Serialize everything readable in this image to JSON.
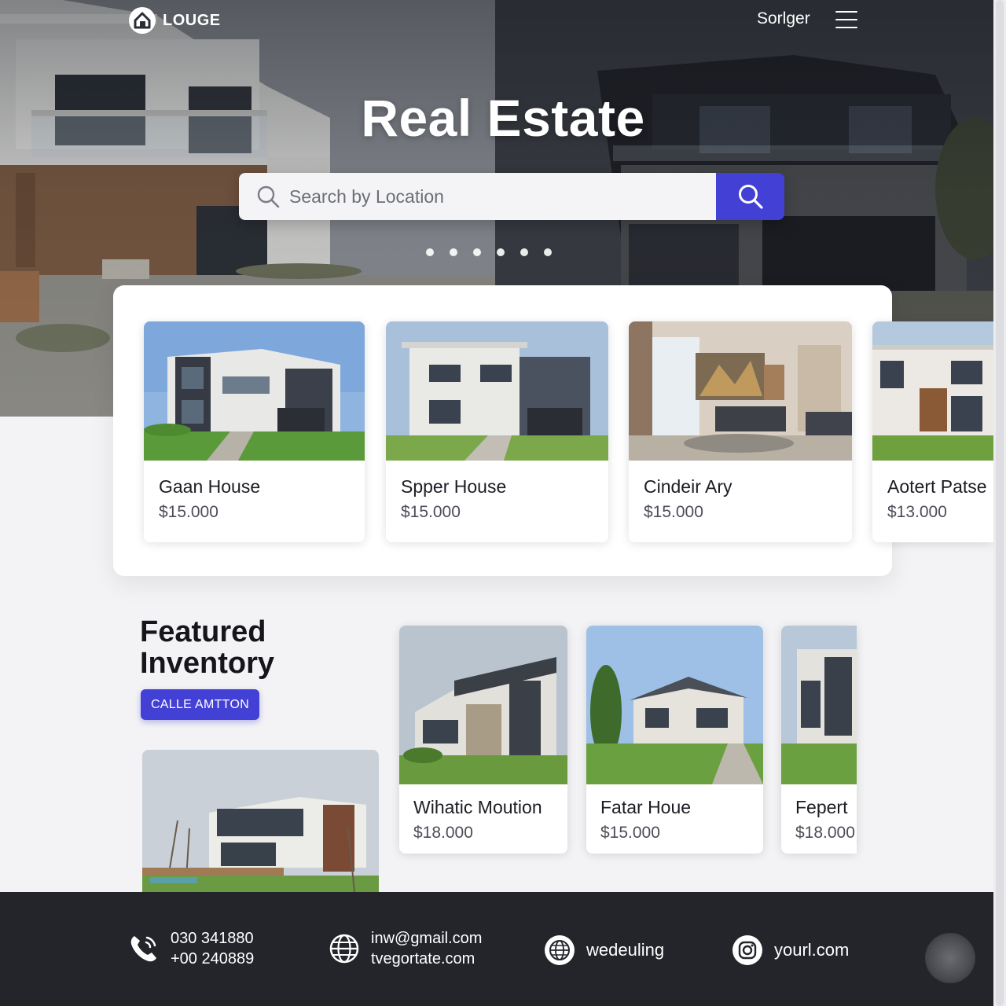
{
  "brand": {
    "name": "LOUGE"
  },
  "nav": {
    "link": "Sorlger",
    "menu_icon": "hamburger-menu-icon"
  },
  "hero": {
    "title": "Real Estate",
    "search_placeholder": "Search by Location",
    "carousel_dots": 6
  },
  "listings": [
    {
      "name": "Gaan House",
      "price": "$15.000",
      "photo": "modern-house-dark"
    },
    {
      "name": "Spper House",
      "price": "$15.000",
      "photo": "modern-house-grey"
    },
    {
      "name": "Cindeir Ary",
      "price": "$15.000",
      "photo": "living-room-interior"
    },
    {
      "name": "Aotert Patse",
      "price": "$13.000",
      "photo": "house-wood-accent"
    }
  ],
  "featured": {
    "title_line1": "Featured",
    "title_line2": "Inventory",
    "cta_label": "CALLE AMTTON",
    "cards": [
      {
        "name": "Wihatic Moution",
        "price": "$18.000"
      },
      {
        "name": "Fatar Houe",
        "price": "$15.000"
      },
      {
        "name": "Fepert",
        "price": "$18.000"
      }
    ]
  },
  "footer": {
    "phone": {
      "line1": "030 341880",
      "line2": "+00 240889",
      "icon": "phone-icon"
    },
    "web": {
      "line1": "inw@gmail.com",
      "line2": "tvegortate.com",
      "icon": "globe-icon"
    },
    "social": {
      "label": "wedeuling",
      "icon": "globe-circle-icon"
    },
    "instagram": {
      "label": "yourl.com",
      "icon": "instagram-icon"
    }
  },
  "colors": {
    "accent": "#4340d6",
    "footer_bg": "#23252b",
    "page_bg": "#f3f3f5"
  }
}
